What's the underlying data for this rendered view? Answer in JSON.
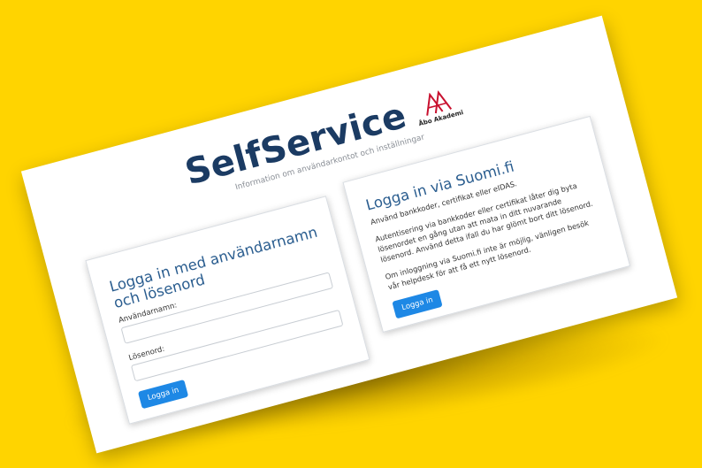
{
  "brand": {
    "title": "SelfService",
    "logo_text": "Åbo Akademi",
    "subtitle": "Information om användarkontot och inställningar"
  },
  "login_form": {
    "title": "Logga in med användarnamn och lösenord",
    "username_label": "Användarnamn:",
    "username_value": "",
    "password_label": "Lösenord:",
    "password_value": "",
    "submit_label": "Logga in"
  },
  "suomi": {
    "title": "Logga in via Suomi.fi",
    "intro": "Använd bankkoder, certifikat eller eIDAS.",
    "info": "Autentisering via bankkoder eller certifikat låter dig byta lösenordet en gång utan att mata in ditt nuvarande lösenord. Använd detta ifall du har glömt bort ditt lösenord.",
    "help": "Om inloggning via Suomi.fi inte är möjlig, vänligen besök vår helpdesk för att få ett nytt lösenord.",
    "submit_label": "Logga in"
  },
  "colors": {
    "background": "#ffd400",
    "brand_text": "#1b3b63",
    "heading": "#2a5d8f",
    "button": "#1e88e5",
    "logo_red": "#c8102e"
  }
}
